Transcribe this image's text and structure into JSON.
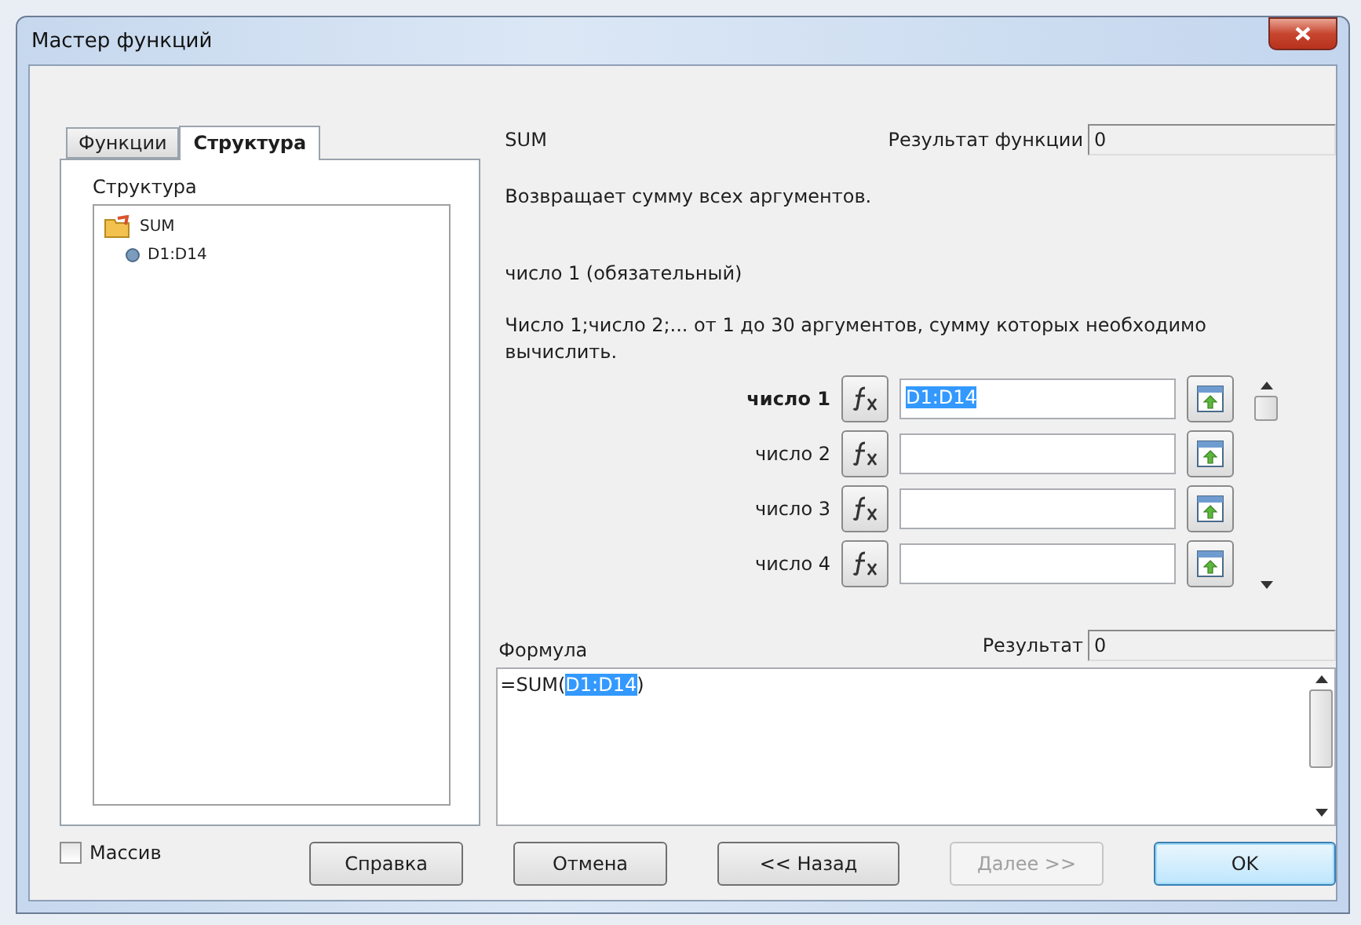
{
  "window": {
    "title": "Мастер функций"
  },
  "tabs": [
    {
      "label": "Функции",
      "selected": false
    },
    {
      "label": "Структура",
      "selected": true
    }
  ],
  "structure": {
    "label": "Структура",
    "tree": [
      {
        "label": "SUM",
        "kind": "function",
        "children": [
          {
            "label": "D1:D14",
            "kind": "reference"
          }
        ]
      }
    ]
  },
  "function": {
    "name": "SUM",
    "result_label": "Результат функции",
    "result": "0",
    "description": "Возвращает сумму всех аргументов.",
    "argument_title": "число 1 (обязательный)",
    "argument_description": "Число 1;число 2;... от 1 до 30 аргументов, сумму которых необходимо вычислить."
  },
  "arguments": [
    {
      "label": "число 1",
      "required": true,
      "value": "D1:D14",
      "value_selected": true
    },
    {
      "label": "число 2",
      "required": false
    },
    {
      "label": "число 3",
      "required": false
    },
    {
      "label": "число 4",
      "required": false
    }
  ],
  "formula": {
    "label": "Формула",
    "result_label": "Результат",
    "result": "0",
    "prefix": "=SUM(",
    "selected": "D1:D14",
    "suffix": ")"
  },
  "array": {
    "label": "Массив",
    "checked": false
  },
  "buttons": [
    {
      "label": "Справка",
      "disabled": false,
      "default": false
    },
    {
      "label": "Отмена",
      "disabled": false,
      "default": false
    },
    {
      "label": "<< Назад",
      "disabled": false,
      "default": false
    },
    {
      "label": "Далее >>",
      "disabled": true,
      "default": false
    },
    {
      "label": "OK",
      "disabled": false,
      "default": true
    }
  ]
}
